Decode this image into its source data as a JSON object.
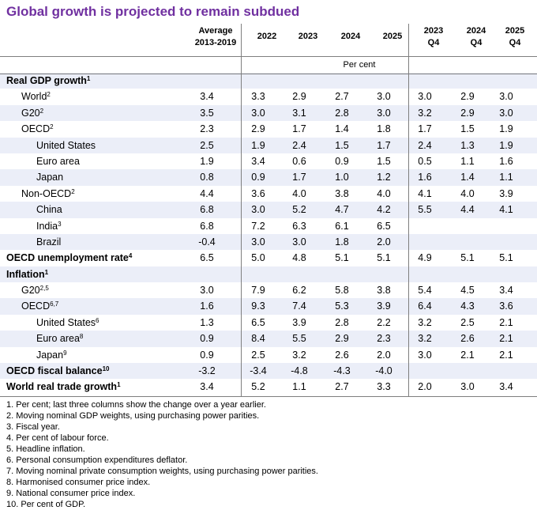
{
  "title": "Global growth is projected to remain subdued",
  "columns": {
    "avg": [
      "Average",
      "2013-2019"
    ],
    "y2022": "2022",
    "y2023": "2023",
    "y2024": "2024",
    "y2025": "2025",
    "q2023": [
      "2023",
      "Q4"
    ],
    "q2024": [
      "2024",
      "Q4"
    ],
    "q2025": [
      "2025",
      "Q4"
    ],
    "unit": "Per cent"
  },
  "rows": [
    {
      "label": "Real GDP growth",
      "sup": "1",
      "level": 0,
      "bold": true,
      "shaded": true,
      "values": [
        "",
        "",
        "",
        "",
        "",
        "",
        "",
        ""
      ]
    },
    {
      "label": "World",
      "sup": "2",
      "level": 1,
      "bold": false,
      "shaded": false,
      "values": [
        "3.4",
        "3.3",
        "2.9",
        "2.7",
        "3.0",
        "3.0",
        "2.9",
        "3.0"
      ]
    },
    {
      "label": "G20",
      "sup": "2",
      "level": 1,
      "bold": false,
      "shaded": true,
      "values": [
        "3.5",
        "3.0",
        "3.1",
        "2.8",
        "3.0",
        "3.2",
        "2.9",
        "3.0"
      ]
    },
    {
      "label": "OECD",
      "sup": "2",
      "level": 1,
      "bold": false,
      "shaded": false,
      "values": [
        "2.3",
        "2.9",
        "1.7",
        "1.4",
        "1.8",
        "1.7",
        "1.5",
        "1.9"
      ]
    },
    {
      "label": "United States",
      "sup": "",
      "level": 2,
      "bold": false,
      "shaded": true,
      "values": [
        "2.5",
        "1.9",
        "2.4",
        "1.5",
        "1.7",
        "2.4",
        "1.3",
        "1.9"
      ]
    },
    {
      "label": "Euro area",
      "sup": "",
      "level": 2,
      "bold": false,
      "shaded": false,
      "values": [
        "1.9",
        "3.4",
        "0.6",
        "0.9",
        "1.5",
        "0.5",
        "1.1",
        "1.6"
      ]
    },
    {
      "label": "Japan",
      "sup": "",
      "level": 2,
      "bold": false,
      "shaded": true,
      "values": [
        "0.8",
        "0.9",
        "1.7",
        "1.0",
        "1.2",
        "1.6",
        "1.4",
        "1.1"
      ]
    },
    {
      "label": "Non-OECD",
      "sup": "2",
      "level": 1,
      "bold": false,
      "shaded": false,
      "values": [
        "4.4",
        "3.6",
        "4.0",
        "3.8",
        "4.0",
        "4.1",
        "4.0",
        "3.9"
      ]
    },
    {
      "label": "China",
      "sup": "",
      "level": 2,
      "bold": false,
      "shaded": true,
      "values": [
        "6.8",
        "3.0",
        "5.2",
        "4.7",
        "4.2",
        "5.5",
        "4.4",
        "4.1"
      ]
    },
    {
      "label": "India",
      "sup": "3",
      "level": 2,
      "bold": false,
      "shaded": false,
      "values": [
        "6.8",
        "7.2",
        "6.3",
        "6.1",
        "6.5",
        "",
        "",
        ""
      ]
    },
    {
      "label": "Brazil",
      "sup": "",
      "level": 2,
      "bold": false,
      "shaded": true,
      "values": [
        "-0.4",
        "3.0",
        "3.0",
        "1.8",
        "2.0",
        "",
        "",
        ""
      ]
    },
    {
      "label": "OECD unemployment rate",
      "sup": "4",
      "level": 0,
      "bold": true,
      "shaded": false,
      "values": [
        "6.5",
        "5.0",
        "4.8",
        "5.1",
        "5.1",
        "4.9",
        "5.1",
        "5.1"
      ]
    },
    {
      "label": "Inflation",
      "sup": "1",
      "level": 0,
      "bold": true,
      "shaded": true,
      "values": [
        "",
        "",
        "",
        "",
        "",
        "",
        "",
        ""
      ]
    },
    {
      "label": "G20",
      "sup": "2,5",
      "level": 1,
      "bold": false,
      "shaded": false,
      "values": [
        "3.0",
        "7.9",
        "6.2",
        "5.8",
        "3.8",
        "5.4",
        "4.5",
        "3.4"
      ]
    },
    {
      "label": "OECD",
      "sup": "6,7",
      "level": 1,
      "bold": false,
      "shaded": true,
      "values": [
        "1.6",
        "9.3",
        "7.4",
        "5.3",
        "3.9",
        "6.4",
        "4.3",
        "3.6"
      ]
    },
    {
      "label": "United States",
      "sup": "6",
      "level": 2,
      "bold": false,
      "shaded": false,
      "values": [
        "1.3",
        "6.5",
        "3.9",
        "2.8",
        "2.2",
        "3.2",
        "2.5",
        "2.1"
      ]
    },
    {
      "label": "Euro area",
      "sup": "8",
      "level": 2,
      "bold": false,
      "shaded": true,
      "values": [
        "0.9",
        "8.4",
        "5.5",
        "2.9",
        "2.3",
        "3.2",
        "2.6",
        "2.1"
      ]
    },
    {
      "label": "Japan",
      "sup": "9",
      "level": 2,
      "bold": false,
      "shaded": false,
      "values": [
        "0.9",
        "2.5",
        "3.2",
        "2.6",
        "2.0",
        "3.0",
        "2.1",
        "2.1"
      ]
    },
    {
      "label": "OECD fiscal balance",
      "sup": "10",
      "level": 0,
      "bold": true,
      "shaded": true,
      "values": [
        "-3.2",
        "-3.4",
        "-4.8",
        "-4.3",
        "-4.0",
        "",
        "",
        ""
      ]
    },
    {
      "label": "World real trade growth",
      "sup": "1",
      "level": 0,
      "bold": true,
      "shaded": false,
      "values": [
        "3.4",
        "5.2",
        "1.1",
        "2.7",
        "3.3",
        "2.0",
        "3.0",
        "3.4"
      ]
    }
  ],
  "notes": [
    "1.  Per cent; last three columns show the change over a year earlier.",
    "2.  Moving nominal GDP weights, using purchasing power parities.",
    "3.  Fiscal year.",
    "4.  Per cent of labour force.",
    "5.  Headline inflation.",
    "6.  Personal consumption expenditures deflator.",
    "7.  Moving nominal private consumption weights, using purchasing power parities.",
    "8.  Harmonised consumer price index.",
    "9.  National consumer price index.",
    "10.  Per cent of GDP."
  ],
  "colors": {
    "title": "#7030a0",
    "shade": "#ebeef8",
    "rule": "#7f7f7f"
  }
}
